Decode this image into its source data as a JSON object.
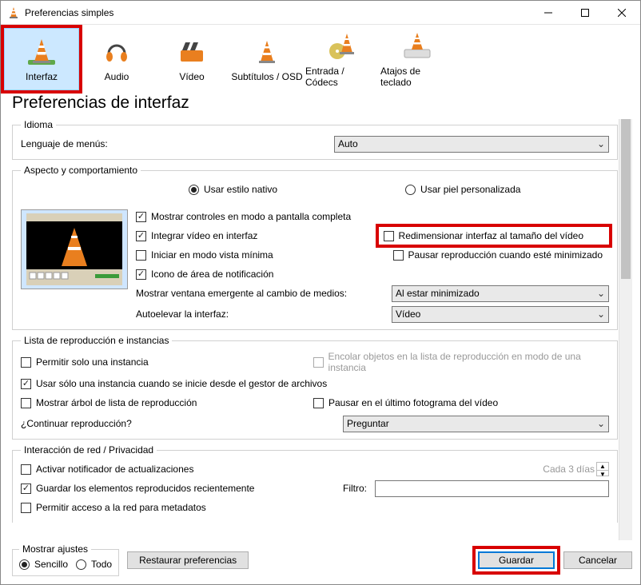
{
  "title": "Preferencias simples",
  "tabs": {
    "interfaz": "Interfaz",
    "audio": "Audio",
    "video": "Vídeo",
    "subs": "Subtítulos / OSD",
    "input": "Entrada / Códecs",
    "hotkeys": "Atajos de teclado"
  },
  "pageTitle": "Preferencias de interfaz",
  "idioma": {
    "legend": "Idioma",
    "menu_label": "Lenguaje de menús:",
    "menu_value": "Auto"
  },
  "aspecto": {
    "legend": "Aspecto y comportamiento",
    "estilo_nativo": "Usar estilo nativo",
    "piel_pers": "Usar piel personalizada",
    "fullscreen": "Mostrar controles en modo a pantalla completa",
    "integrar": "Integrar vídeo en interfaz",
    "redim": "Redimensionar interfaz al tamaño del vídeo",
    "iniciar_min": "Iniciar en modo vista mínima",
    "pausar_min": "Pausar reproducción cuando esté minimizado",
    "tray": "Icono de área de notificación",
    "popup_label": "Mostrar ventana emergente al cambio de medios:",
    "popup_value": "Al estar minimizado",
    "autoraise_label": "Autoelevar la interfaz:",
    "autoraise_value": "Vídeo"
  },
  "playlist": {
    "legend": "Lista de reproducción e instancias",
    "one_instance": "Permitir solo una instancia",
    "enqueue": "Encolar objetos en la lista de reproducción en modo de una instancia",
    "one_from_fm": "Usar sólo una instancia cuando se inicie desde el gestor de archivos",
    "tree": "Mostrar árbol de lista de reproducción",
    "pause_last": "Pausar en el último fotograma del vídeo",
    "continue_label": "¿Continuar reproducción?",
    "continue_value": "Preguntar"
  },
  "privacy": {
    "legend": "Interacción de red / Privacidad",
    "updates": "Activar notificador de actualizaciones",
    "every_label": "Cada 3 días",
    "save_recent": "Guardar los elementos reproducidos recientemente",
    "filter_label": "Filtro:",
    "allow_meta": "Permitir acceso a la red para metadatos"
  },
  "footer": {
    "mostrar": "Mostrar ajustes",
    "sencillo": "Sencillo",
    "todo": "Todo",
    "reset": "Restaurar preferencias",
    "save": "Guardar",
    "cancel": "Cancelar"
  }
}
